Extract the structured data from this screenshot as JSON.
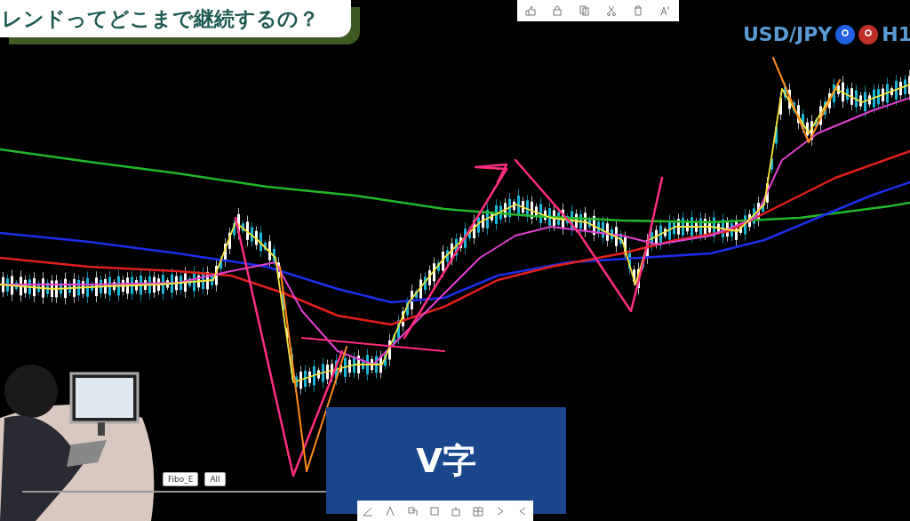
{
  "title_banner": {
    "text": "レンドってどこまで継続するの？"
  },
  "chart_header": {
    "symbol": "USD/JPY",
    "timeframe": "H1"
  },
  "chart_buttons": [
    {
      "label": "Fibo_E"
    },
    {
      "label": "All"
    }
  ],
  "caption": {
    "text": "V字"
  }
}
